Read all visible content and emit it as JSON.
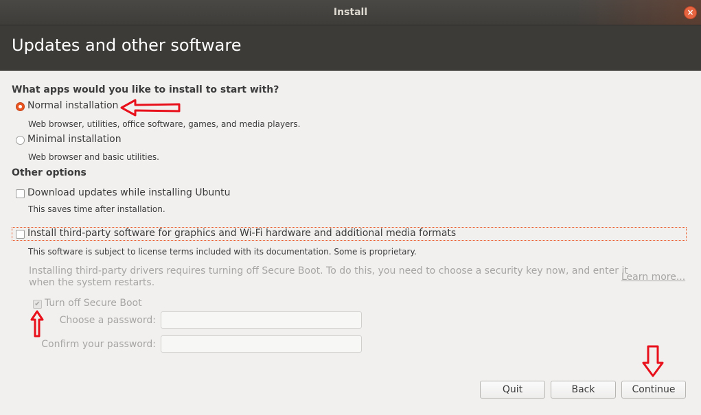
{
  "window": {
    "title": "Install",
    "close_glyph": "×"
  },
  "header": {
    "title": "Updates and other software"
  },
  "apps_section": {
    "heading": "What apps would you like to install to start with?",
    "normal": {
      "label": "Normal installation",
      "description": "Web browser, utilities, office software, games, and media players.",
      "selected": true
    },
    "minimal": {
      "label": "Minimal installation",
      "description": "Web browser and basic utilities.",
      "selected": false
    }
  },
  "other_section": {
    "heading": "Other options",
    "download_updates": {
      "label": "Download updates while installing Ubuntu",
      "description": "This saves time after installation.",
      "checked": false
    },
    "third_party": {
      "label": "Install third-party software for graphics and Wi-Fi hardware and additional media formats",
      "description": "This software is subject to license terms included with its documentation. Some is proprietary.",
      "checked": false
    }
  },
  "secure_boot": {
    "notice_line1": "Installing third-party drivers requires turning off Secure Boot. To do this, you need to choose a security key now, and enter it",
    "notice_line2": "when the system restarts.",
    "learn_more": "Learn more...",
    "turn_off_label": "Turn off Secure Boot",
    "check_glyph": "✔",
    "choose_password_label": "Choose a password:",
    "confirm_password_label": "Confirm your password:",
    "choose_password_value": "",
    "confirm_password_value": ""
  },
  "buttons": {
    "quit": "Quit",
    "back": "Back",
    "continue": "Continue"
  },
  "colors": {
    "accent": "#e95420",
    "annotation_red": "#e8101a",
    "header_bg": "#3c3b37"
  },
  "annotations": [
    "red-arrow-left",
    "red-arrow-up",
    "red-arrow-down"
  ]
}
